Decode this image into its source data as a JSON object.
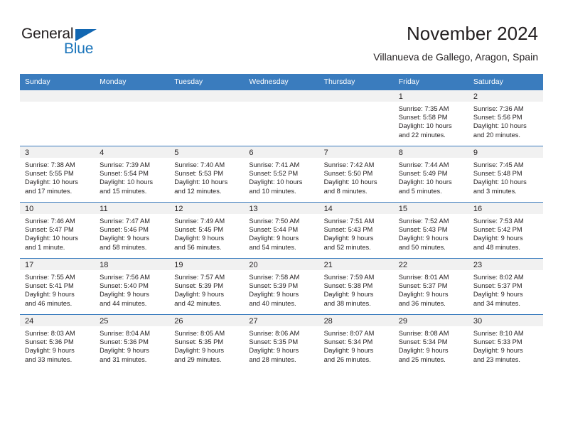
{
  "brand": {
    "name_part1": "General",
    "name_part2": "Blue",
    "triangle_color": "#1267b2",
    "blue_color": "#1b75bb"
  },
  "header": {
    "title": "November 2024",
    "subtitle": "Villanueva de Gallego, Aragon, Spain"
  },
  "theme": {
    "header_bg": "#3a7cbe",
    "daynum_bg": "#f1f1f1",
    "grid_line": "#3a7cbe",
    "text": "#231f20"
  },
  "weekdays": [
    "Sunday",
    "Monday",
    "Tuesday",
    "Wednesday",
    "Thursday",
    "Friday",
    "Saturday"
  ],
  "labels": {
    "sunrise_prefix": "Sunrise:",
    "sunset_prefix": "Sunset:",
    "daylight_prefix": "Daylight:"
  },
  "weeks": [
    [
      {
        "day": "",
        "blank": true,
        "sunrise": "",
        "sunset": "",
        "daylight_line1": "",
        "daylight_line2": ""
      },
      {
        "day": "",
        "blank": true,
        "sunrise": "",
        "sunset": "",
        "daylight_line1": "",
        "daylight_line2": ""
      },
      {
        "day": "",
        "blank": true,
        "sunrise": "",
        "sunset": "",
        "daylight_line1": "",
        "daylight_line2": ""
      },
      {
        "day": "",
        "blank": true,
        "sunrise": "",
        "sunset": "",
        "daylight_line1": "",
        "daylight_line2": ""
      },
      {
        "day": "",
        "blank": true,
        "sunrise": "",
        "sunset": "",
        "daylight_line1": "",
        "daylight_line2": ""
      },
      {
        "day": "1",
        "blank": false,
        "sunrise": "Sunrise: 7:35 AM",
        "sunset": "Sunset: 5:58 PM",
        "daylight_line1": "Daylight: 10 hours",
        "daylight_line2": "and 22 minutes."
      },
      {
        "day": "2",
        "blank": false,
        "sunrise": "Sunrise: 7:36 AM",
        "sunset": "Sunset: 5:56 PM",
        "daylight_line1": "Daylight: 10 hours",
        "daylight_line2": "and 20 minutes."
      }
    ],
    [
      {
        "day": "3",
        "blank": false,
        "sunrise": "Sunrise: 7:38 AM",
        "sunset": "Sunset: 5:55 PM",
        "daylight_line1": "Daylight: 10 hours",
        "daylight_line2": "and 17 minutes."
      },
      {
        "day": "4",
        "blank": false,
        "sunrise": "Sunrise: 7:39 AM",
        "sunset": "Sunset: 5:54 PM",
        "daylight_line1": "Daylight: 10 hours",
        "daylight_line2": "and 15 minutes."
      },
      {
        "day": "5",
        "blank": false,
        "sunrise": "Sunrise: 7:40 AM",
        "sunset": "Sunset: 5:53 PM",
        "daylight_line1": "Daylight: 10 hours",
        "daylight_line2": "and 12 minutes."
      },
      {
        "day": "6",
        "blank": false,
        "sunrise": "Sunrise: 7:41 AM",
        "sunset": "Sunset: 5:52 PM",
        "daylight_line1": "Daylight: 10 hours",
        "daylight_line2": "and 10 minutes."
      },
      {
        "day": "7",
        "blank": false,
        "sunrise": "Sunrise: 7:42 AM",
        "sunset": "Sunset: 5:50 PM",
        "daylight_line1": "Daylight: 10 hours",
        "daylight_line2": "and 8 minutes."
      },
      {
        "day": "8",
        "blank": false,
        "sunrise": "Sunrise: 7:44 AM",
        "sunset": "Sunset: 5:49 PM",
        "daylight_line1": "Daylight: 10 hours",
        "daylight_line2": "and 5 minutes."
      },
      {
        "day": "9",
        "blank": false,
        "sunrise": "Sunrise: 7:45 AM",
        "sunset": "Sunset: 5:48 PM",
        "daylight_line1": "Daylight: 10 hours",
        "daylight_line2": "and 3 minutes."
      }
    ],
    [
      {
        "day": "10",
        "blank": false,
        "sunrise": "Sunrise: 7:46 AM",
        "sunset": "Sunset: 5:47 PM",
        "daylight_line1": "Daylight: 10 hours",
        "daylight_line2": "and 1 minute."
      },
      {
        "day": "11",
        "blank": false,
        "sunrise": "Sunrise: 7:47 AM",
        "sunset": "Sunset: 5:46 PM",
        "daylight_line1": "Daylight: 9 hours",
        "daylight_line2": "and 58 minutes."
      },
      {
        "day": "12",
        "blank": false,
        "sunrise": "Sunrise: 7:49 AM",
        "sunset": "Sunset: 5:45 PM",
        "daylight_line1": "Daylight: 9 hours",
        "daylight_line2": "and 56 minutes."
      },
      {
        "day": "13",
        "blank": false,
        "sunrise": "Sunrise: 7:50 AM",
        "sunset": "Sunset: 5:44 PM",
        "daylight_line1": "Daylight: 9 hours",
        "daylight_line2": "and 54 minutes."
      },
      {
        "day": "14",
        "blank": false,
        "sunrise": "Sunrise: 7:51 AM",
        "sunset": "Sunset: 5:43 PM",
        "daylight_line1": "Daylight: 9 hours",
        "daylight_line2": "and 52 minutes."
      },
      {
        "day": "15",
        "blank": false,
        "sunrise": "Sunrise: 7:52 AM",
        "sunset": "Sunset: 5:43 PM",
        "daylight_line1": "Daylight: 9 hours",
        "daylight_line2": "and 50 minutes."
      },
      {
        "day": "16",
        "blank": false,
        "sunrise": "Sunrise: 7:53 AM",
        "sunset": "Sunset: 5:42 PM",
        "daylight_line1": "Daylight: 9 hours",
        "daylight_line2": "and 48 minutes."
      }
    ],
    [
      {
        "day": "17",
        "blank": false,
        "sunrise": "Sunrise: 7:55 AM",
        "sunset": "Sunset: 5:41 PM",
        "daylight_line1": "Daylight: 9 hours",
        "daylight_line2": "and 46 minutes."
      },
      {
        "day": "18",
        "blank": false,
        "sunrise": "Sunrise: 7:56 AM",
        "sunset": "Sunset: 5:40 PM",
        "daylight_line1": "Daylight: 9 hours",
        "daylight_line2": "and 44 minutes."
      },
      {
        "day": "19",
        "blank": false,
        "sunrise": "Sunrise: 7:57 AM",
        "sunset": "Sunset: 5:39 PM",
        "daylight_line1": "Daylight: 9 hours",
        "daylight_line2": "and 42 minutes."
      },
      {
        "day": "20",
        "blank": false,
        "sunrise": "Sunrise: 7:58 AM",
        "sunset": "Sunset: 5:39 PM",
        "daylight_line1": "Daylight: 9 hours",
        "daylight_line2": "and 40 minutes."
      },
      {
        "day": "21",
        "blank": false,
        "sunrise": "Sunrise: 7:59 AM",
        "sunset": "Sunset: 5:38 PM",
        "daylight_line1": "Daylight: 9 hours",
        "daylight_line2": "and 38 minutes."
      },
      {
        "day": "22",
        "blank": false,
        "sunrise": "Sunrise: 8:01 AM",
        "sunset": "Sunset: 5:37 PM",
        "daylight_line1": "Daylight: 9 hours",
        "daylight_line2": "and 36 minutes."
      },
      {
        "day": "23",
        "blank": false,
        "sunrise": "Sunrise: 8:02 AM",
        "sunset": "Sunset: 5:37 PM",
        "daylight_line1": "Daylight: 9 hours",
        "daylight_line2": "and 34 minutes."
      }
    ],
    [
      {
        "day": "24",
        "blank": false,
        "sunrise": "Sunrise: 8:03 AM",
        "sunset": "Sunset: 5:36 PM",
        "daylight_line1": "Daylight: 9 hours",
        "daylight_line2": "and 33 minutes."
      },
      {
        "day": "25",
        "blank": false,
        "sunrise": "Sunrise: 8:04 AM",
        "sunset": "Sunset: 5:36 PM",
        "daylight_line1": "Daylight: 9 hours",
        "daylight_line2": "and 31 minutes."
      },
      {
        "day": "26",
        "blank": false,
        "sunrise": "Sunrise: 8:05 AM",
        "sunset": "Sunset: 5:35 PM",
        "daylight_line1": "Daylight: 9 hours",
        "daylight_line2": "and 29 minutes."
      },
      {
        "day": "27",
        "blank": false,
        "sunrise": "Sunrise: 8:06 AM",
        "sunset": "Sunset: 5:35 PM",
        "daylight_line1": "Daylight: 9 hours",
        "daylight_line2": "and 28 minutes."
      },
      {
        "day": "28",
        "blank": false,
        "sunrise": "Sunrise: 8:07 AM",
        "sunset": "Sunset: 5:34 PM",
        "daylight_line1": "Daylight: 9 hours",
        "daylight_line2": "and 26 minutes."
      },
      {
        "day": "29",
        "blank": false,
        "sunrise": "Sunrise: 8:08 AM",
        "sunset": "Sunset: 5:34 PM",
        "daylight_line1": "Daylight: 9 hours",
        "daylight_line2": "and 25 minutes."
      },
      {
        "day": "30",
        "blank": false,
        "sunrise": "Sunrise: 8:10 AM",
        "sunset": "Sunset: 5:33 PM",
        "daylight_line1": "Daylight: 9 hours",
        "daylight_line2": "and 23 minutes."
      }
    ]
  ]
}
